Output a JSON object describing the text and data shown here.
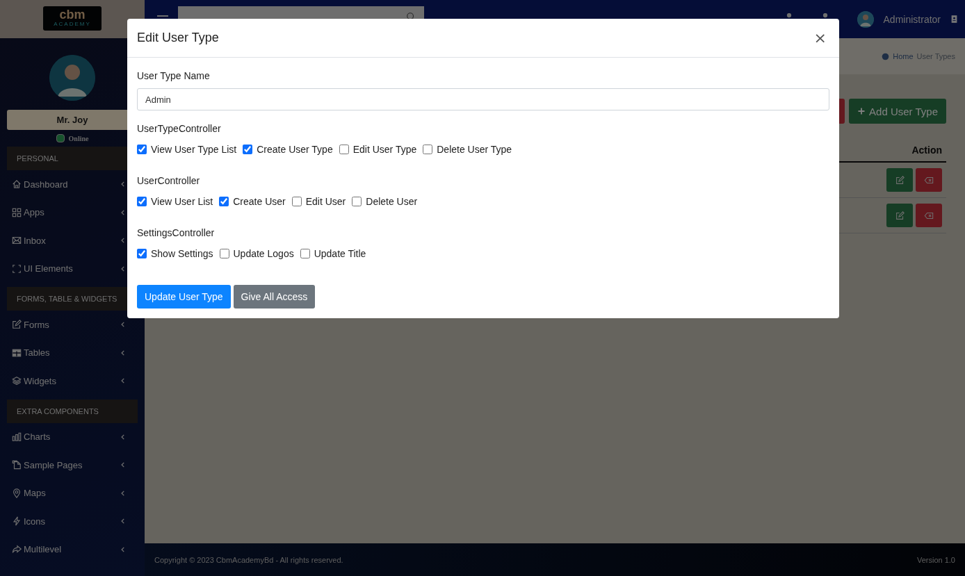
{
  "logo": {
    "mark": "cbm",
    "subtitle": "ACADEMY"
  },
  "profile": {
    "name": "Mr. Joy",
    "status": "Online"
  },
  "sidebar": {
    "sections": [
      {
        "title": "PERSONAL",
        "items": [
          {
            "label": "Dashboard"
          },
          {
            "label": "Apps"
          },
          {
            "label": "Inbox"
          },
          {
            "label": "UI Elements"
          }
        ]
      },
      {
        "title": "FORMS, TABLE & WIDGETS",
        "items": [
          {
            "label": "Forms"
          },
          {
            "label": "Tables"
          },
          {
            "label": "Widgets"
          }
        ]
      },
      {
        "title": "EXTRA COMPONENTS",
        "items": [
          {
            "label": "Charts"
          },
          {
            "label": "Sample Pages"
          },
          {
            "label": "Maps"
          },
          {
            "label": "Icons"
          },
          {
            "label": "Multilevel"
          }
        ]
      }
    ]
  },
  "header": {
    "user": "Administrator"
  },
  "breadcrumb": [
    {
      "label": "Home"
    },
    {
      "label": "User Types"
    }
  ],
  "page": {
    "add_button": "Add User Type",
    "table": {
      "columns": [
        "Action"
      ],
      "rows": [
        {
          "actions": [
            {
              "kind": "edit"
            },
            {
              "kind": "delete"
            }
          ]
        },
        {
          "actions": [
            {
              "kind": "edit"
            },
            {
              "kind": "delete"
            }
          ]
        }
      ]
    }
  },
  "modal": {
    "title": "Edit User Type",
    "close": "×",
    "name_label": "User Type Name",
    "name_value": "Admin",
    "groups": [
      {
        "title": "UserTypeController",
        "permissions": [
          {
            "label": "View User Type List",
            "checked": true
          },
          {
            "label": "Create User Type",
            "checked": true
          },
          {
            "label": "Edit User Type",
            "checked": false
          },
          {
            "label": "Delete User Type",
            "checked": false
          }
        ]
      },
      {
        "title": "UserController",
        "permissions": [
          {
            "label": "View User List",
            "checked": true
          },
          {
            "label": "Create User",
            "checked": true
          },
          {
            "label": "Edit User",
            "checked": false
          },
          {
            "label": "Delete User",
            "checked": false
          }
        ]
      },
      {
        "title": "SettingsController",
        "permissions": [
          {
            "label": "Show Settings",
            "checked": true
          },
          {
            "label": "Update Logos",
            "checked": false
          },
          {
            "label": "Update Title",
            "checked": false
          }
        ]
      }
    ],
    "buttons": [
      {
        "label": "Update User Type",
        "kind": "primary"
      },
      {
        "label": "Give All Access",
        "kind": "secondary"
      }
    ]
  },
  "footer": {
    "copyright": "Copyright © 2023 CbmAcademyBd - All rights reserved.",
    "version": "Version 1.0"
  }
}
